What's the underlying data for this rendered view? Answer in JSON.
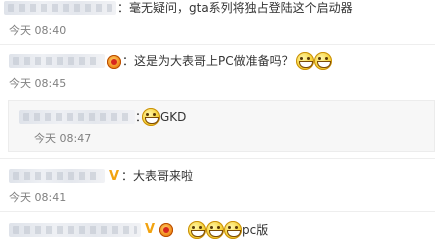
{
  "comments": [
    {
      "text": "：毫无疑问，gta系列将独占登陆这个启动器",
      "time": "今天 08:40"
    },
    {
      "text": "：这是为大表哥上PC做准备吗？",
      "time": "今天 08:45",
      "reply": {
        "text": "：",
        "text_after": "GKD",
        "time": "今天 08:47"
      }
    },
    {
      "text": "：大表哥来啦",
      "time": "今天 08:41",
      "badge": "V"
    },
    {
      "text": "pc版",
      "badge": "V"
    }
  ],
  "colors": {
    "text": "#333333",
    "time": "#808080",
    "badge": "#f2a30f",
    "quote_background": "#f7f7f7"
  }
}
